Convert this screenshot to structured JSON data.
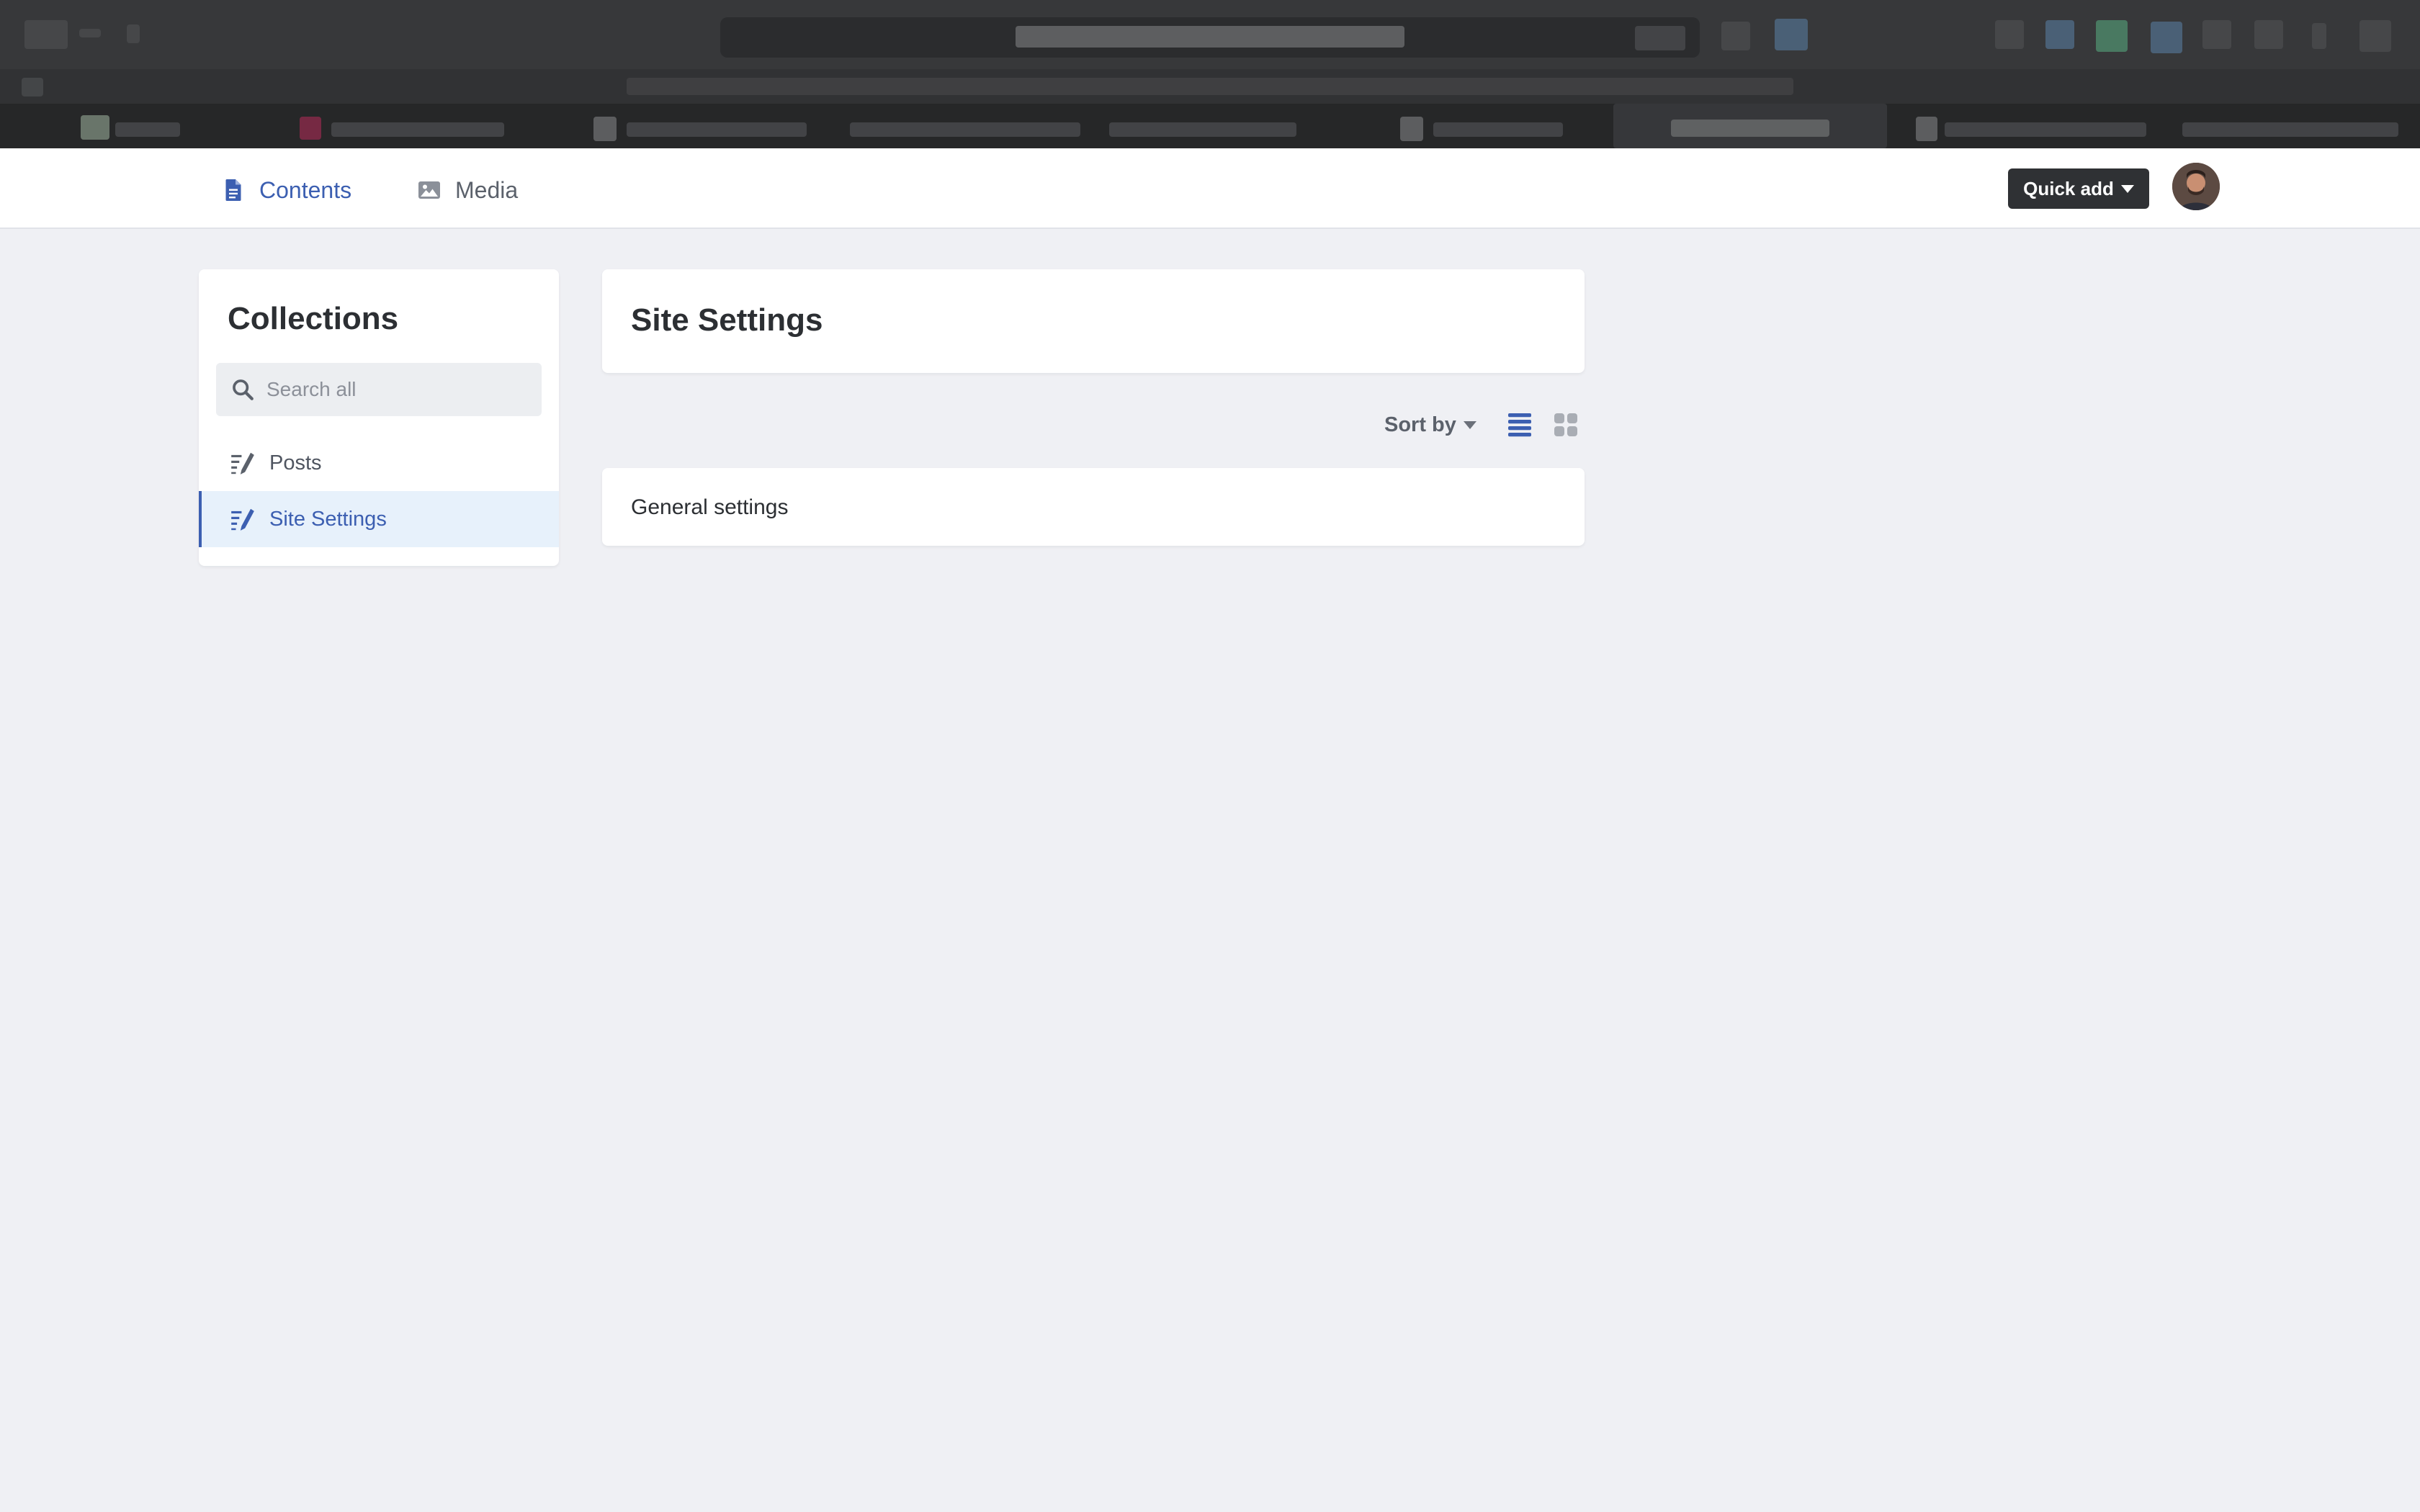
{
  "nav": {
    "contents_label": "Contents",
    "media_label": "Media",
    "quick_add_label": "Quick add"
  },
  "sidebar": {
    "title": "Collections",
    "search_placeholder": "Search all",
    "items": [
      {
        "label": "Posts",
        "icon": "collection-icon",
        "active": false
      },
      {
        "label": "Site Settings",
        "icon": "collection-icon",
        "active": true
      }
    ]
  },
  "main": {
    "title": "Site Settings",
    "sort_label": "Sort by",
    "entries": [
      {
        "label": "General settings"
      }
    ]
  },
  "colors": {
    "accent": "#3c5fb1",
    "active_bg": "#e7f1fb",
    "background": "#eff0f4",
    "button_dark": "#2f3134"
  }
}
